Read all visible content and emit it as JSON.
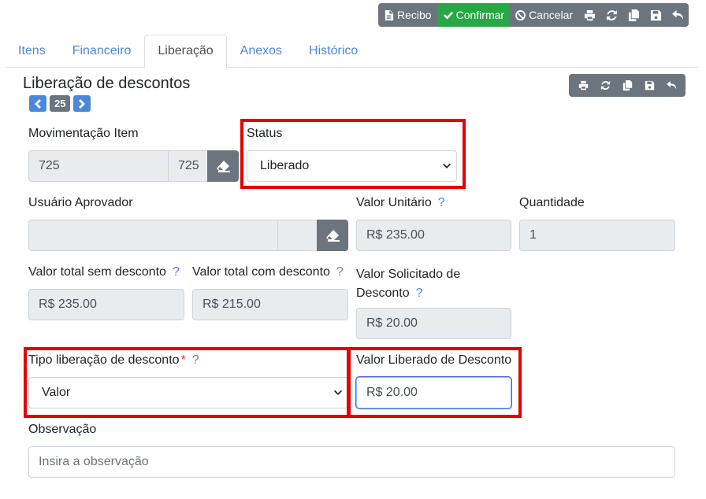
{
  "toolbar": {
    "recibo_label": "Recibo",
    "confirmar_label": "Confirmar",
    "cancelar_label": "Cancelar"
  },
  "tabs": [
    {
      "label": "Itens"
    },
    {
      "label": "Financeiro"
    },
    {
      "label": "Liberação"
    },
    {
      "label": "Anexos"
    },
    {
      "label": "Histórico"
    }
  ],
  "section": {
    "title": "Liberação de descontos",
    "page_number": "25"
  },
  "form": {
    "movimentacao_item": {
      "label": "Movimentação Item",
      "value": "725",
      "code": "725"
    },
    "status": {
      "label": "Status",
      "value": "Liberado"
    },
    "usuario_aprovador": {
      "label": "Usuário Aprovador",
      "value": ""
    },
    "valor_unitario": {
      "label": "Valor Unitário",
      "help": "?",
      "value": "R$ 235.00"
    },
    "quantidade": {
      "label": "Quantidade",
      "value": "1"
    },
    "valor_total_sem_desconto": {
      "label": "Valor total sem desconto",
      "help": "?",
      "value": "R$ 235.00"
    },
    "valor_total_com_desconto": {
      "label": "Valor total com desconto",
      "help": "?",
      "value": "R$ 215.00"
    },
    "valor_solicitado": {
      "label_line1": "Valor Solicitado de",
      "label_line2": "Desconto",
      "help": "?",
      "value": "R$ 20.00"
    },
    "tipo_liberacao": {
      "label": "Tipo liberação de desconto",
      "required": "*",
      "help": "?",
      "value": "Valor"
    },
    "valor_liberado": {
      "label": "Valor Liberado de Desconto",
      "value": "R$ 20.00"
    },
    "observacao": {
      "label": "Observação",
      "placeholder": "Insira a observação"
    }
  },
  "colors": {
    "primary": "#4b88d8",
    "secondary": "#6c757d",
    "success": "#28a745",
    "highlight": "#e30000"
  },
  "icons": [
    "file-pdf-icon",
    "check-icon",
    "ban-icon",
    "print-icon",
    "sync-icon",
    "copy-icon",
    "save-icon",
    "undo-icon",
    "chevron-left-icon",
    "chevron-right-icon",
    "eraser-icon",
    "chevron-down-icon"
  ]
}
